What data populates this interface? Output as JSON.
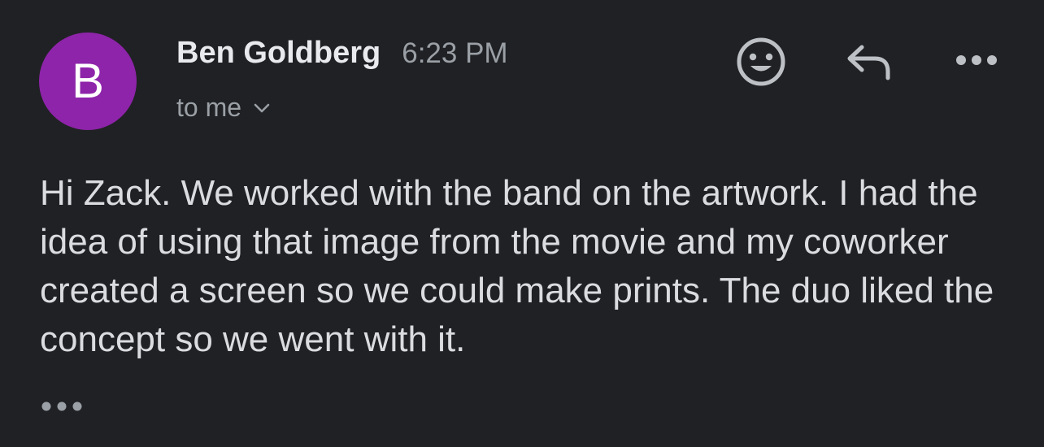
{
  "avatar": {
    "letter": "B",
    "color": "#8e24aa"
  },
  "message": {
    "sender_name": "Ben Goldberg",
    "timestamp": "6:23 PM",
    "recipient_label": "to me",
    "body": "Hi Zack. We worked with the band on the artwork. I had the idea of using that image from the movie and my coworker created a screen so we could make prints. The duo liked the concept so we went with it."
  },
  "icons": {
    "recipient_toggle": "chevron-down-icon",
    "emoji": "smiley-icon",
    "reply": "reply-icon",
    "more": "more-horizontal-icon",
    "trimmed_content": "ellipsis-icon"
  },
  "colors": {
    "background": "#202124",
    "primary_text": "#e8eaed",
    "secondary_text": "#9aa0a6",
    "icon": "#bdc1c6"
  }
}
